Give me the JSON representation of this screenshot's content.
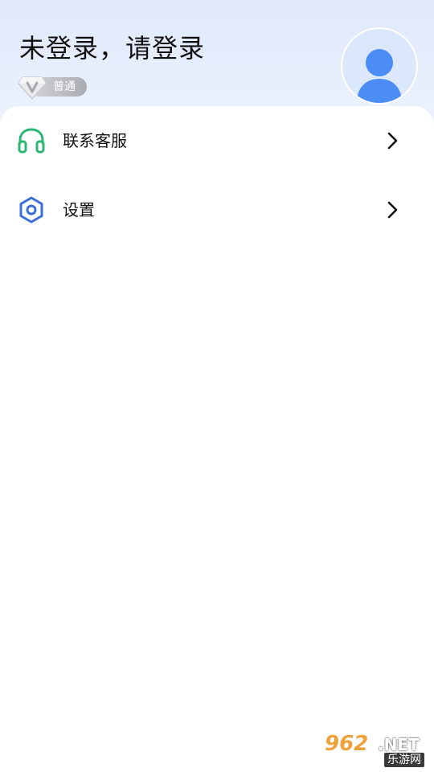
{
  "profile": {
    "login_prompt": "未登录，请登录",
    "member_level": "普通",
    "member_icon": "v-shield-icon",
    "avatar_icon": "user-avatar-icon"
  },
  "menu": {
    "items": [
      {
        "label": "联系客服",
        "icon": "headset-icon",
        "icon_color": "#2bb673"
      },
      {
        "label": "设置",
        "icon": "settings-hexagon-icon",
        "icon_color": "#3a6fd8"
      }
    ]
  },
  "watermark": {
    "number": "962",
    "suffix": ".NET",
    "caption": "乐游网"
  },
  "colors": {
    "header_gradient_top": "#dfe9fb",
    "avatar_blue": "#4b8df5",
    "text_primary": "#111111"
  }
}
